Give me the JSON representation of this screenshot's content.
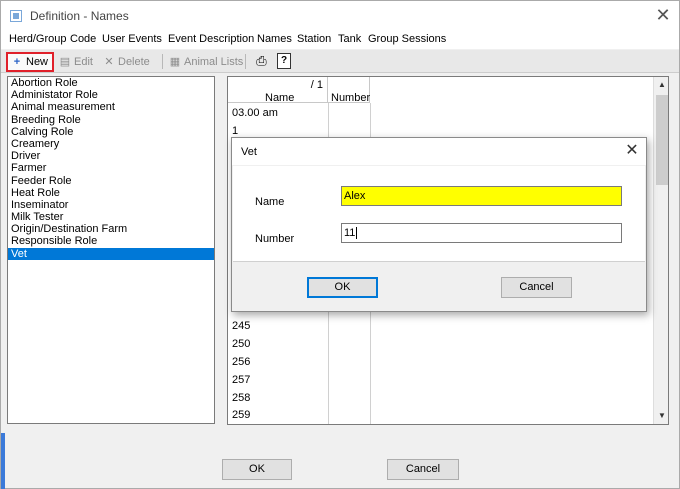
{
  "window": {
    "title": "Definition - Names",
    "close_glyph": "✕"
  },
  "menu": [
    "Herd/Group",
    "Code",
    "User Events",
    "Event Description",
    "Names",
    "Station",
    "Tank",
    "Group Sessions"
  ],
  "toolbar": {
    "new_label": "New",
    "edit_label": "Edit",
    "delete_label": "Delete",
    "animal_lists_label": "Animal Lists",
    "icons": {
      "new": "plus-icon",
      "edit": "edit-icon",
      "delete": "delete-icon",
      "animal_lists": "list-icon",
      "print": "printer-icon",
      "help": "help-icon"
    }
  },
  "roles": {
    "items": [
      "Abortion Role",
      "Administator Role",
      "Animal measurement",
      "Breeding Role",
      "Calving Role",
      "Creamery",
      "Driver",
      "Farmer",
      "Feeder Role",
      "Heat Role",
      "Inseminator",
      "Milk Tester",
      "Origin/Destination Farm",
      "Responsible Role",
      "Vet"
    ],
    "selected": "Vet"
  },
  "grid": {
    "count_label": "/ 1",
    "columns": [
      "Name",
      "Number"
    ],
    "rows_top": [
      "03.00 am",
      "1"
    ],
    "rows_bottom": [
      "245",
      "250",
      "256",
      "257",
      "258",
      "259"
    ]
  },
  "dialog": {
    "title": "Vet",
    "name_label": "Name",
    "name_value": "Alex",
    "number_label": "Number",
    "number_value": "11",
    "ok_label": "OK",
    "cancel_label": "Cancel",
    "highlight_color": "#ffff00"
  },
  "footer": {
    "ok_label": "OK",
    "cancel_label": "Cancel"
  },
  "colors": {
    "selection": "#0078d7",
    "new_button_outline": "#e0202a"
  }
}
